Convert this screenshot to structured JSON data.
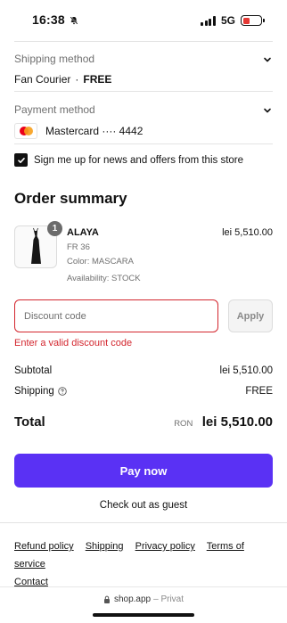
{
  "status_bar": {
    "time": "16:38",
    "network": "5G"
  },
  "shipping": {
    "label": "Shipping method",
    "carrier": "Fan Courier",
    "separator": "·",
    "price": "FREE"
  },
  "payment": {
    "label": "Payment method",
    "card": "Mastercard ···· 4442",
    "card_icon": "mastercard-icon"
  },
  "newsletter": {
    "label": "Sign me up for news and offers from this store",
    "checked": true
  },
  "order_summary": {
    "title": "Order summary",
    "item": {
      "quantity": "1",
      "name": "ALAYA",
      "size": "FR 36",
      "color": "Color: MASCARA",
      "availability": "Availability: STOCK",
      "price": "lei 5,510.00"
    },
    "discount": {
      "placeholder": "Discount code",
      "apply_label": "Apply",
      "error": "Enter a valid discount code"
    },
    "subtotal_label": "Subtotal",
    "subtotal_value": "lei 5,510.00",
    "shipping_label": "Shipping",
    "shipping_value": "FREE",
    "total_label": "Total",
    "total_currency": "RON",
    "total_value": "lei 5,510.00"
  },
  "actions": {
    "pay_now": "Pay now",
    "guest": "Check out as guest"
  },
  "footer": {
    "links": [
      "Refund policy",
      "Shipping",
      "Privacy policy",
      "Terms of service",
      "Contact"
    ]
  },
  "browser": {
    "url": "shop.app",
    "url_suffix": "– Privat"
  },
  "colors": {
    "accent": "#5a31f4",
    "error": "#d3262e"
  }
}
